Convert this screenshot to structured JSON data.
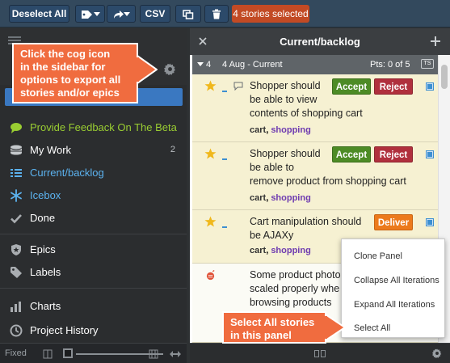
{
  "toolbar": {
    "deselect_all": "Deselect All",
    "csv": "CSV",
    "selected_badge": "4 stories selected"
  },
  "sidebar": {
    "nav": [
      {
        "label": "Provide Feedback On The Beta",
        "color": "#9acd32",
        "icon": "chat-bubble-icon"
      },
      {
        "label": "My Work",
        "count": "2",
        "icon": "stack-icon"
      },
      {
        "label": "Current/backlog",
        "icon": "list-icon",
        "color": "#5cb3f0"
      },
      {
        "label": "Icebox",
        "icon": "snowflake-icon",
        "color": "#5cb3f0"
      },
      {
        "label": "Done",
        "icon": "check-icon"
      },
      {
        "label": "Epics",
        "icon": "shield-star-icon"
      },
      {
        "label": "Labels",
        "icon": "tag-icon"
      },
      {
        "label": "Charts",
        "icon": "bar-chart-icon"
      },
      {
        "label": "Project History",
        "icon": "clock-icon"
      }
    ],
    "fixed_label": "Fixed"
  },
  "panel": {
    "title": "Current/backlog",
    "iteration": {
      "number": "4",
      "label": "4 Aug - Current",
      "points": "Pts: 0 of 5",
      "badge": "TS"
    },
    "stories": [
      {
        "title_lines": [
          "Shopper should",
          "be able to view",
          "contents of shopping cart"
        ],
        "labels": [
          "cart",
          "shopping"
        ],
        "actions": [
          "Accept",
          "Reject"
        ]
      },
      {
        "title_lines": [
          "Shopper should",
          "be able to",
          "remove product from shopping cart"
        ],
        "labels": [
          "cart",
          "shopping"
        ],
        "actions": [
          "Accept",
          "Reject"
        ]
      },
      {
        "title_lines": [
          "Cart manipulation should",
          "be AJAXy"
        ],
        "labels": [
          "cart",
          "shopping"
        ],
        "actions": [
          "Deliver"
        ]
      },
      {
        "title_lines": [
          "Some product photo",
          "scaled properly whe",
          "browsing products"
        ],
        "labels": [],
        "actions": []
      }
    ]
  },
  "menu": {
    "items": [
      "Clone Panel",
      "Collapse All Iterations",
      "Expand All Iterations",
      "Select All"
    ]
  },
  "callouts": {
    "cog": [
      "Click the cog icon",
      "in the sidebar for",
      "options to export all",
      "stories and/or epics"
    ],
    "select_all": [
      "Select All stories",
      "in this panel"
    ]
  },
  "colors": {
    "toolbar_bg": "#33495d",
    "accept": "#4d8b25",
    "reject": "#b0303d",
    "deliver": "#ec7a1c",
    "callout": "#f06c3f",
    "story_bg": "#f6f1d2"
  }
}
